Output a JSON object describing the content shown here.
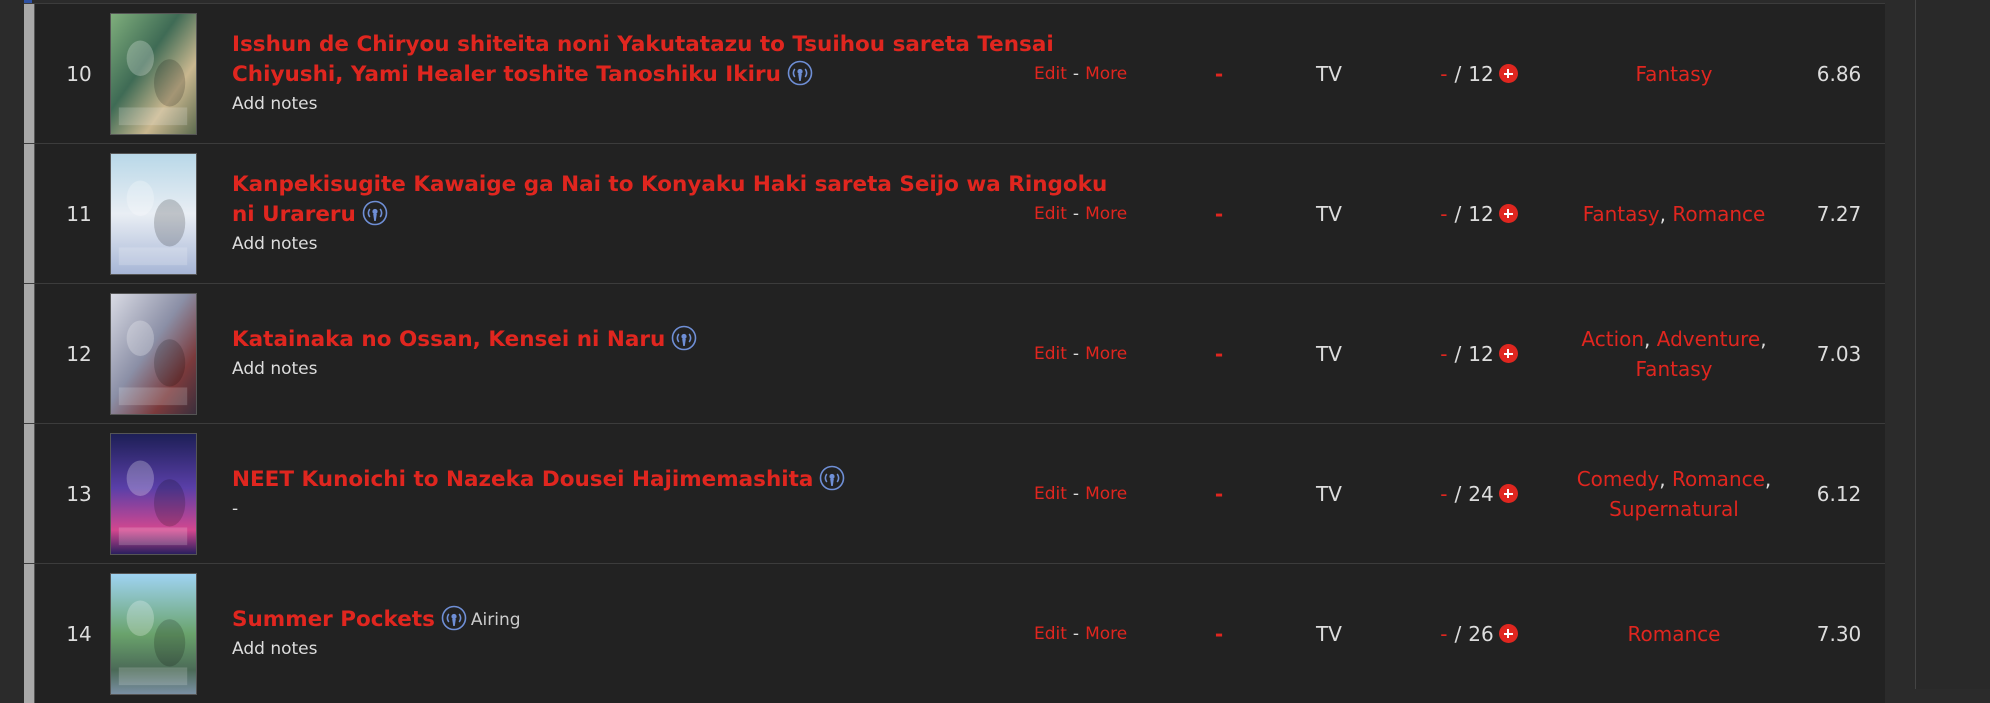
{
  "rows": [
    {
      "num": "10",
      "title_line1": "Isshun de Chiryou shiteita noni Yakutatazu to Tsuihou sareta Tensai",
      "title_line2": "Chiyushi, Yami Healer toshite Tanoshiku Ikiru",
      "airing_label": "",
      "notes": "Add notes",
      "edit": "Edit",
      "more": "More",
      "score": "-",
      "type": "TV",
      "progress_current": "-",
      "progress_total": "12",
      "genres": [
        "Fantasy"
      ],
      "rating": "6.86"
    },
    {
      "num": "11",
      "title_line1": "Kanpekisugite Kawaige ga Nai to Konyaku Haki sareta Seijo wa Ringoku",
      "title_line2": "ni Urareru",
      "airing_label": "",
      "notes": "Add notes",
      "edit": "Edit",
      "more": "More",
      "score": "-",
      "type": "TV",
      "progress_current": "-",
      "progress_total": "12",
      "genres": [
        "Fantasy",
        "Romance"
      ],
      "rating": "7.27"
    },
    {
      "num": "12",
      "title_line1": "Katainaka no Ossan, Kensei ni Naru",
      "title_line2": "",
      "airing_label": "",
      "notes": "Add notes",
      "edit": "Edit",
      "more": "More",
      "score": "-",
      "type": "TV",
      "progress_current": "-",
      "progress_total": "12",
      "genres": [
        "Action",
        "Adventure",
        "Fantasy"
      ],
      "rating": "7.03"
    },
    {
      "num": "13",
      "title_line1": "NEET Kunoichi to Nazeka Dousei Hajimemashita",
      "title_line2": "",
      "airing_label": "",
      "notes": "-",
      "edit": "Edit",
      "more": "More",
      "score": "-",
      "type": "TV",
      "progress_current": "-",
      "progress_total": "24",
      "genres": [
        "Comedy",
        "Romance",
        "Supernatural"
      ],
      "rating": "6.12"
    },
    {
      "num": "14",
      "title_line1": "Summer Pockets",
      "title_line2": "",
      "airing_label": "Airing",
      "notes": "Add notes",
      "edit": "Edit",
      "more": "More",
      "score": "-",
      "type": "TV",
      "progress_current": "-",
      "progress_total": "26",
      "genres": [
        "Romance"
      ],
      "rating": "7.30"
    }
  ],
  "separators": {
    "edit_more": "-",
    "progress": "/",
    "genre": ","
  },
  "icons": {
    "airing": "airing-broadcast-icon",
    "increment": "plus-circle-icon"
  },
  "colors": {
    "link": "#e0261f",
    "text": "#dddddd",
    "row_bg": "#222222",
    "status_bar": "#a9a9a9",
    "airing_icon": "#6f8fd6"
  }
}
